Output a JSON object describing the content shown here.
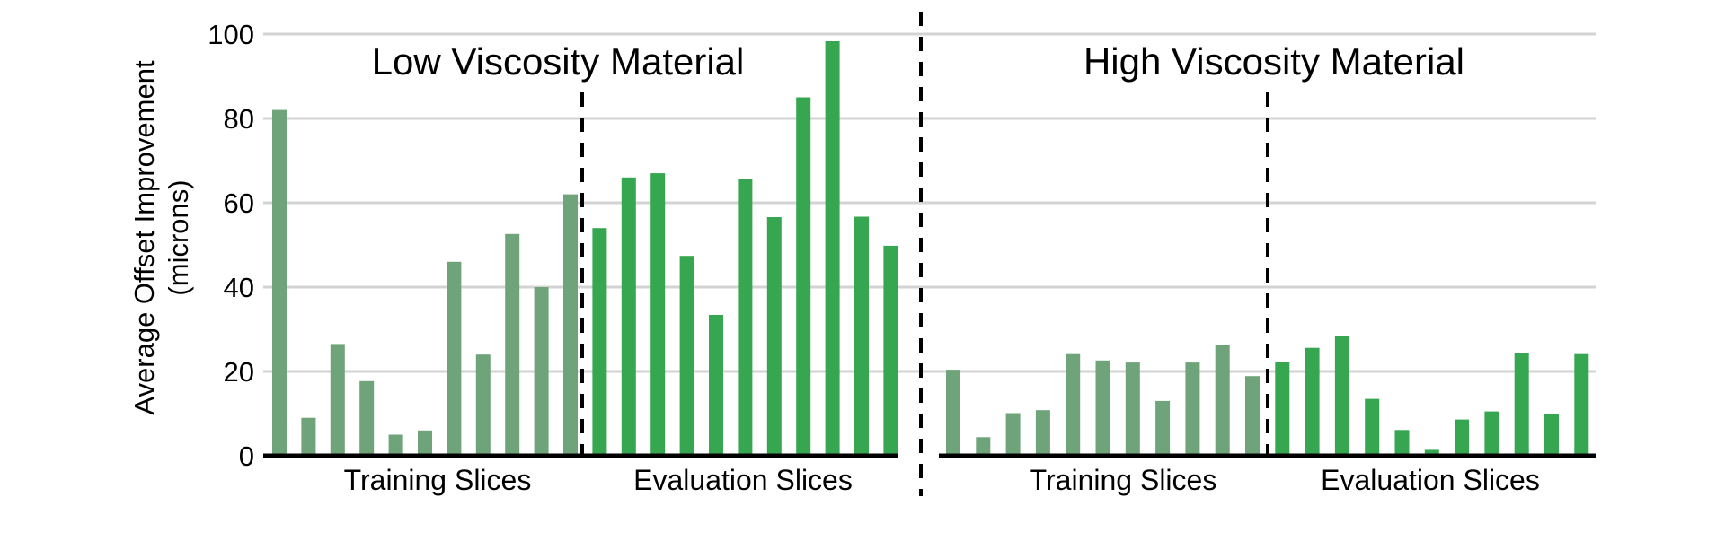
{
  "chart_data": {
    "type": "bar",
    "ylabel": [
      "Average Offset Improvement",
      "(microns)"
    ],
    "xlabel": "",
    "ylim": [
      0,
      100
    ],
    "yticks": [
      0,
      20,
      40,
      60,
      80,
      100
    ],
    "grid": true,
    "colors": {
      "training": "#6fa37a",
      "evaluation": "#37a650",
      "grid": "#d3d3d3",
      "axis": "#000000"
    },
    "panels": [
      {
        "title": "Low Viscosity Material",
        "groups": [
          {
            "name": "Training Slices",
            "series": "training",
            "values": [
              82,
              9,
              26.5,
              17.7,
              5,
              6,
              46,
              24,
              52.6,
              40,
              62
            ]
          },
          {
            "name": "Evaluation Slices",
            "series": "evaluation",
            "values": [
              54,
              66,
              67,
              47.4,
              33.4,
              65.7,
              56.6,
              85,
              98.3,
              56.7,
              49.8
            ]
          }
        ]
      },
      {
        "title": "High Viscosity Material",
        "groups": [
          {
            "name": "Training Slices",
            "series": "training",
            "values": [
              20.4,
              4.4,
              10.1,
              10.8,
              24.1,
              22.6,
              22.1,
              13,
              22.1,
              26.3,
              18.9
            ]
          },
          {
            "name": "Evaluation Slices",
            "series": "evaluation",
            "values": [
              22.3,
              25.6,
              28.3,
              13.5,
              6.1,
              1.4,
              8.6,
              10.5,
              24.4,
              10,
              24.1
            ]
          }
        ]
      }
    ]
  }
}
